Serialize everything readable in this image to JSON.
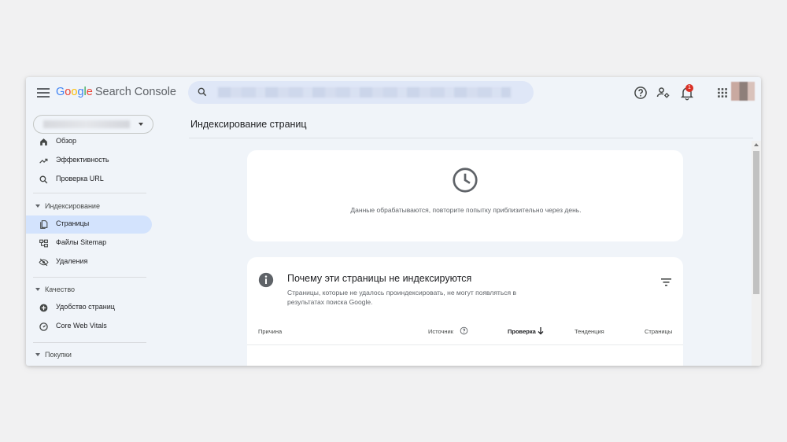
{
  "header": {
    "logo": {
      "g1": "G",
      "o1": "o",
      "o2": "o",
      "g2": "g",
      "l": "l",
      "e": "e",
      "product": "Search Console"
    },
    "notification_count": "1"
  },
  "sidebar": {
    "items": [
      {
        "label": "Обзор",
        "icon": "home-icon"
      },
      {
        "label": "Эффективность",
        "icon": "trending-up-icon"
      },
      {
        "label": "Проверка URL",
        "icon": "search-icon"
      }
    ],
    "sections": [
      {
        "label": "Индексирование",
        "items": [
          {
            "label": "Страницы",
            "icon": "pages-icon",
            "active": true
          },
          {
            "label": "Файлы Sitemap",
            "icon": "sitemap-icon"
          },
          {
            "label": "Удаления",
            "icon": "visibility-off-icon"
          }
        ]
      },
      {
        "label": "Качество",
        "items": [
          {
            "label": "Удобство страниц",
            "icon": "add-circle-icon"
          },
          {
            "label": "Core Web Vitals",
            "icon": "speed-icon"
          }
        ]
      },
      {
        "label": "Покупки",
        "items": []
      }
    ]
  },
  "main": {
    "page_title": "Индексирование страниц",
    "processing_card": {
      "icon": "clock-icon",
      "message": "Данные обрабатываются, повторите попытку приблизительно через день."
    },
    "reasons_card": {
      "icon": "info-icon",
      "title": "Почему эти страницы не индексируются",
      "subtitle": "Страницы, которые не удалось проиндексировать, не могут появляться в результатах поиска Google.",
      "columns": [
        "Причина",
        "Источник",
        "Проверка",
        "Тенденция",
        "Страницы"
      ]
    }
  },
  "colors": {
    "accent": "#d3e3fd",
    "background": "#f0f4f9",
    "badge": "#d93025"
  }
}
